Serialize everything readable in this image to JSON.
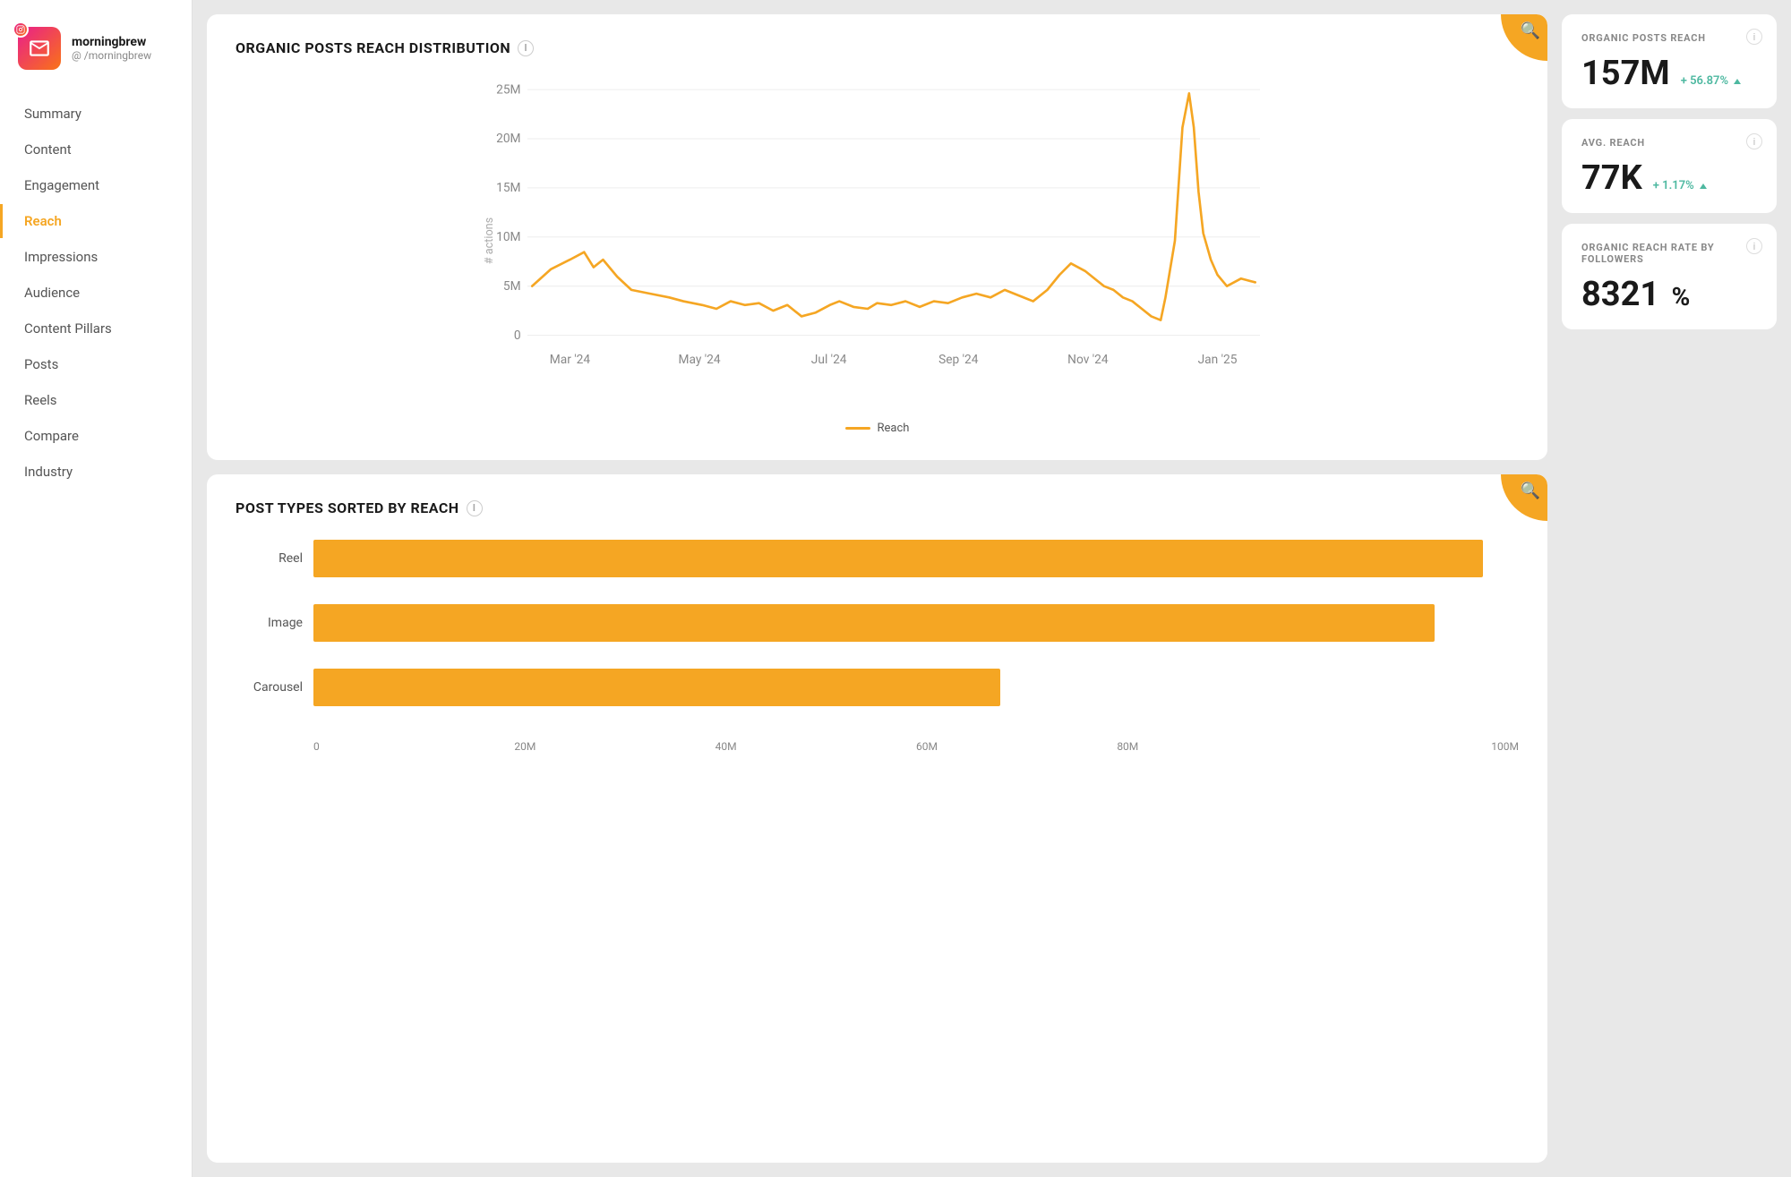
{
  "brand": {
    "name": "morningbrew",
    "handle": "@ /morningbrew"
  },
  "nav": {
    "items": [
      {
        "id": "summary",
        "label": "Summary",
        "active": false
      },
      {
        "id": "content",
        "label": "Content",
        "active": false
      },
      {
        "id": "engagement",
        "label": "Engagement",
        "active": false
      },
      {
        "id": "reach",
        "label": "Reach",
        "active": true
      },
      {
        "id": "impressions",
        "label": "Impressions",
        "active": false
      },
      {
        "id": "audience",
        "label": "Audience",
        "active": false
      },
      {
        "id": "content-pillars",
        "label": "Content Pillars",
        "active": false
      },
      {
        "id": "posts",
        "label": "Posts",
        "active": false
      },
      {
        "id": "reels",
        "label": "Reels",
        "active": false
      },
      {
        "id": "compare",
        "label": "Compare",
        "active": false
      },
      {
        "id": "industry",
        "label": "Industry",
        "active": false
      }
    ]
  },
  "chart1": {
    "title": "ORGANIC POSTS REACH DISTRIBUTION",
    "legend": "Reach",
    "yLabels": [
      "25M",
      "20M",
      "15M",
      "10M",
      "5M",
      "0"
    ],
    "xLabels": [
      "Mar '24",
      "May '24",
      "Jul '24",
      "Sep '24",
      "Nov '24",
      "Jan '25"
    ],
    "yAxisLabel": "# actions"
  },
  "chart2": {
    "title": "POST TYPES SORTED BY REACH",
    "bars": [
      {
        "label": "Reel",
        "value": 97
      },
      {
        "label": "Image",
        "value": 93
      },
      {
        "label": "Carousel",
        "value": 57
      }
    ],
    "xLabels": [
      "0",
      "20M",
      "40M",
      "60M",
      "80M",
      "100M"
    ]
  },
  "stats": {
    "organicPostsReach": {
      "label": "ORGANIC POSTS REACH",
      "value": "157M",
      "change": "+ 56.87%"
    },
    "avgReach": {
      "label": "AVG. REACH",
      "value": "77K",
      "change": "+ 1.17%"
    },
    "organicReachRate": {
      "label": "ORGANIC REACH RATE BY FOLLOWERS",
      "value": "8321",
      "unit": "%"
    }
  },
  "icons": {
    "search": "🔍",
    "info": "i",
    "instagram": "◎"
  }
}
